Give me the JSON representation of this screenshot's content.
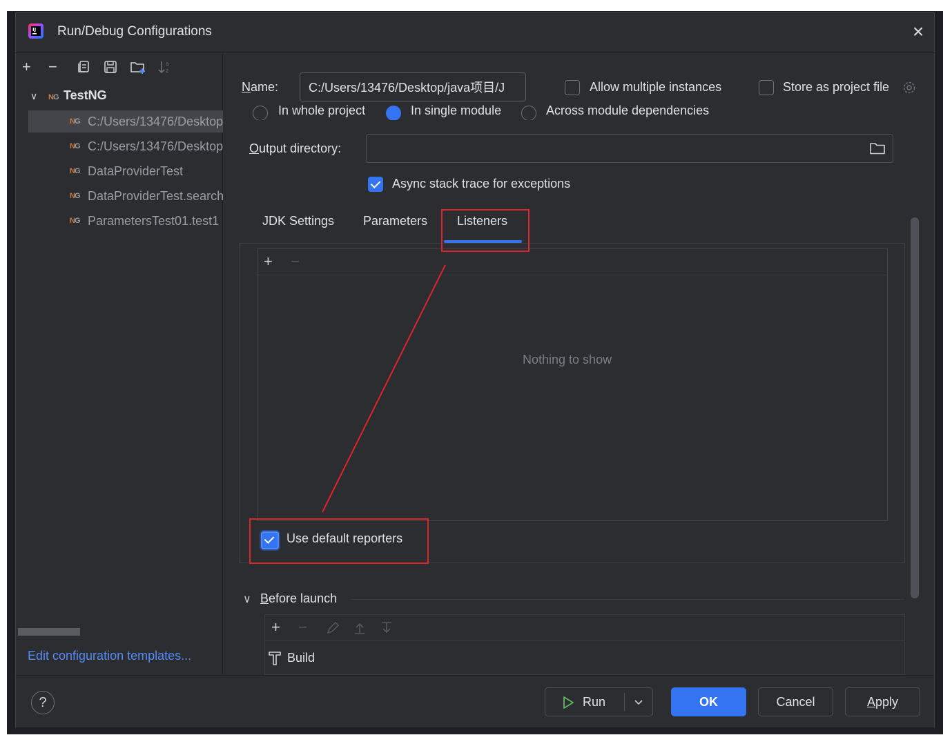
{
  "window": {
    "title": "Run/Debug Configurations",
    "close_icon": "close-icon"
  },
  "left": {
    "toolbar_icons": [
      "add-icon",
      "remove-icon",
      "copy-icon",
      "save-icon",
      "new-folder-icon",
      "sort-icon"
    ],
    "tree": {
      "root": {
        "label": "TestNG",
        "icon": "testng-icon"
      },
      "items": [
        {
          "label": "C:/Users/13476/Desktop",
          "selected": true
        },
        {
          "label": "C:/Users/13476/Desktop",
          "selected": false
        },
        {
          "label": "DataProviderTest",
          "selected": false
        },
        {
          "label": "DataProviderTest.search",
          "selected": false
        },
        {
          "label": "ParametersTest01.test1",
          "selected": false
        }
      ]
    },
    "edit_templates_link": "Edit configuration templates..."
  },
  "form": {
    "name_label": "Name:",
    "name_value": "C:/Users/13476/Desktop/java项目/J",
    "allow_multiple_label": "Allow multiple instances",
    "allow_multiple_checked": false,
    "store_project_label": "Store as project file",
    "store_project_checked": false,
    "scope_options": [
      {
        "label": "In whole project",
        "selected": false
      },
      {
        "label": "In single module",
        "selected": true
      },
      {
        "label": "Across module dependencies",
        "selected": false
      }
    ],
    "output_dir_label": "Output directory:",
    "output_dir_value": "",
    "async_label": "Async stack trace for exceptions",
    "async_checked": true
  },
  "tabs": {
    "items": [
      "JDK Settings",
      "Parameters",
      "Listeners"
    ],
    "active": "Listeners"
  },
  "listeners": {
    "empty_text": "Nothing to show",
    "use_default_label": "Use default reporters",
    "use_default_checked": true
  },
  "before_launch": {
    "label": "Before launch",
    "items": [
      {
        "label": "Build",
        "icon": "hammer-icon"
      }
    ]
  },
  "footer": {
    "help": "?",
    "run_label": "Run",
    "ok_label": "OK",
    "cancel_label": "Cancel",
    "apply_label": "Apply"
  },
  "colors": {
    "accent": "#3574f0",
    "link": "#548af7",
    "annotation": "#e0242b",
    "background": "#2b2d30"
  }
}
